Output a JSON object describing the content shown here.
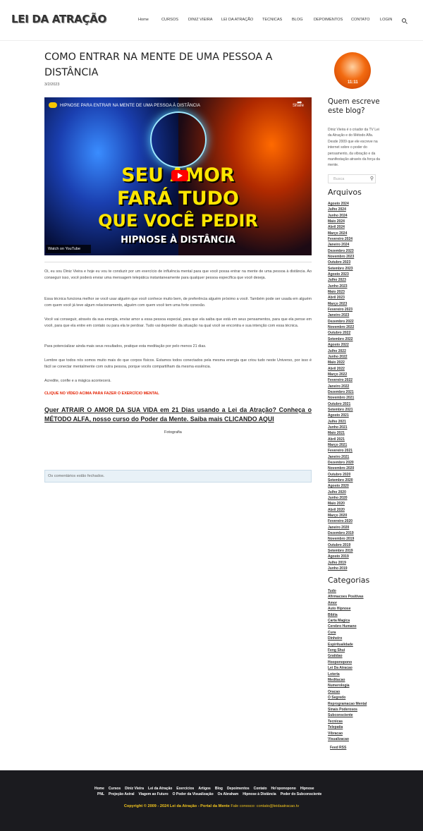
{
  "site": {
    "logo": "LEI DA ATRAÇÃO"
  },
  "nav": [
    "Home",
    "CURSOS",
    "DINIZ VIEIRA",
    "LEI DA ATRAÇÃO",
    "TECNICAS",
    "BLOG",
    "DEPOIMENTOS",
    "CONTATO",
    "LOGIN"
  ],
  "post": {
    "title": "COMO ENTRAR NA MENTE DE UMA PESSOA A DISTÂNCIA",
    "date": "3/2/2023",
    "video": {
      "title": "HIPNOSE PARA ENTRAR NA MENTE DE UMA PESSOA À DISTÂNCIA",
      "share": "Share",
      "line1": "SEU AMOR",
      "line2": "FARÁ TUDO",
      "line3": "QUE VOCÊ PEDIR",
      "line4": "HIPNOSE À DISTÂNCIA",
      "watch": "Watch on YouTube"
    },
    "paragraphs": [
      "Oi, eu sou Diniz Vieira e hoje eu vou te conduzir por um exercício de influência mental para que você possa entrar na mente de uma pessoa à distância. Ao conseguir isso, você poderá enviar uma mensagem telepática instantaneamente para qualquer pessoa específica que você deseja.",
      "Essa técnica funciona melhor se você usar alguém que você conhece muito bem, de preferência alguém próximo a você. Também pode ser usada em alguém com quem você já teve algum relacionamento, alguém com quem você tem uma forte conexão.",
      "Você vai conseguir, através da sua energia, enviar amor a essa pessoa especial, para que ela saiba que está em seus pensamentos, para que ela pense em você, para que ela entre em contato ou para ela te perdoar. Tudo vai depender da situação na qual você se encontra e sua intenção com essa técnica.",
      "Para potencializar ainda mais seus resultados, pratique esta meditação por pelo menos 21 dias.",
      "Lembre que todos nós somos muito mais do que corpos físicos. Estamos todos conectados pela mesma energia que criou tudo neste Universo, por isso é fácil se conectar mentalmente com outra pessoa, porque vocês compartilham da mesma essência.",
      "Acredite, confie e a mágica acontecerá."
    ],
    "cta": "CLIQUE NO VÍDEO ACIMA PARA FAZER O EXERCÍCIO MENTAL",
    "promo": "Quer ATRAIR O AMOR DA SUA VIDA em 21 Dias usando a Lei da Atração? Conheça o MÉTODO ALFA, nosso curso do Poder da Mente. Saiba mais CLICANDO AQUI",
    "image_alt": "Fotografia",
    "comments_closed": "Os comentários estão fechados."
  },
  "sidebar": {
    "author_heading": "Quem escreve este blog?",
    "author_about": "Diniz Vieira é o criador da TV Lei da Atração e do Método Alfa. Desde 2009 que ele escreve na internet sobre o poder do pensamento, da vibração e da manifestação através da força da mente.",
    "avatar_text": "11:11",
    "search_placeholder": "Busca",
    "archives_heading": "Arquivos",
    "archives": [
      "Agosto 2024",
      "Julho 2024",
      "Junho 2024",
      "Maio 2024",
      "Abril 2024",
      "Março 2024",
      "Fevereiro 2024",
      "Janeiro 2024",
      "Dezembro 2023",
      "Novembro 2023",
      "Outubro 2023",
      "Setembro 2023",
      "Agosto 2023",
      "Julho 2023",
      "Junho 2023",
      "Maio 2023",
      "Abril 2023",
      "Março 2023",
      "Fevereiro 2023",
      "Janeiro 2023",
      "Dezembro 2022",
      "Novembro 2022",
      "Outubro 2022",
      "Setembro 2022",
      "Agosto 2022",
      "Julho 2022",
      "Junho 2022",
      "Maio 2022",
      "Abril 2022",
      "Março 2022",
      "Fevereiro 2022",
      "Janeiro 2022",
      "Dezembro 2021",
      "Novembro 2021",
      "Outubro 2021",
      "Setembro 2021",
      "Agosto 2021",
      "Julho 2021",
      "Junho 2021",
      "Maio 2021",
      "Abril 2021",
      "Março 2021",
      "Fevereiro 2021",
      "Janeiro 2021",
      "Dezembro 2020",
      "Novembro 2020",
      "Outubro 2020",
      "Setembro 2020",
      "Agosto 2020",
      "Julho 2020",
      "Junho 2020",
      "Maio 2020",
      "Abril 2020",
      "Março 2020",
      "Fevereiro 2020",
      "Janeiro 2020",
      "Dezembro 2019",
      "Novembro 2019",
      "Outubro 2019",
      "Setembro 2019",
      "Agosto 2019",
      "Julho 2019",
      "Junho 2019"
    ],
    "categories_heading": "Categorias",
    "categories": [
      "Tudo",
      "Afirmacoes Positivas",
      "Amor",
      "Auto Hipnose",
      "Biblia",
      "Carta Magica",
      "Cerebro Humano",
      "Cura",
      "Dinheiro",
      "Espiritualidade",
      "Feng Shui",
      "Gratidao",
      "Hooponopono",
      "Lei Da Atracao",
      "Loteria",
      "Meditacao",
      "Numerologia",
      "Oracao",
      "O Segredo",
      "Reprogramacao Mental",
      "Sinais Poderosos",
      "Subconsciente",
      "Tecnicas",
      "Telepatia",
      "Vibracao",
      "Visualizacao"
    ],
    "rss": "Feed RSS"
  },
  "footer": {
    "row1": [
      "Home",
      "Cursos",
      "Diniz Vieira",
      "Lei da Atração",
      "Exercícios",
      "Artigos",
      "Blog",
      "Depoimentos",
      "Contato",
      "Ho'oponopono",
      "Hipnose"
    ],
    "row2": [
      "PNL",
      "Projeção Astral",
      "Viagem ao Futuro",
      "O Poder da Visualização",
      "Os Abraham",
      "Hipnose à Distância",
      "Poder do Subconsciente"
    ],
    "copyright": "Copyright © 2009 - 2024 Lei da Atração - Portal da Mente",
    "contact": "Fale conosco: contato@leidaatracao.tv"
  }
}
